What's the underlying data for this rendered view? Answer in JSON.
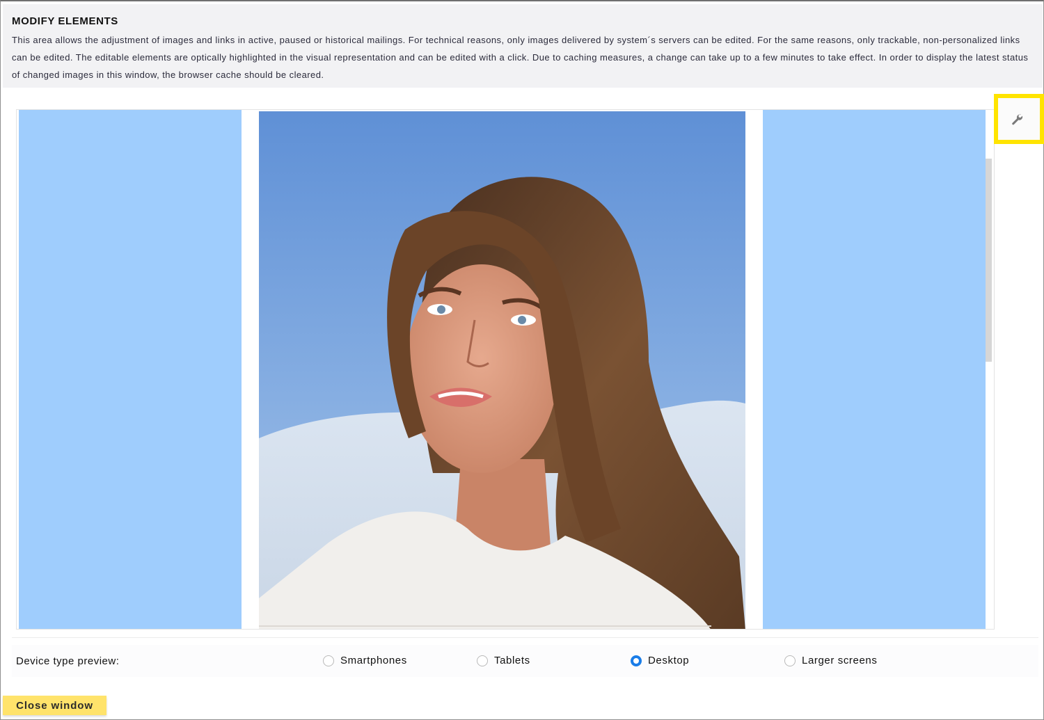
{
  "header": {
    "title": "MODIFY ELEMENTS",
    "description": "This area allows the adjustment of images and links in active, paused or historical mailings. For technical reasons, only images delivered by system´s servers can be edited. For the same reasons, only trackable, non-personalized links can be edited. The editable elements are optically highlighted in the visual representation and can be edited with a click. Due to caching measures, a change can take up to a few minutes to take effect. In order to display the latest status of changed images in this window, the browser cache should be cleared."
  },
  "preview": {
    "highlight_color": "#9fcdfd",
    "tool_icon": "wrench-icon",
    "tool_highlight_color": "#ffe400"
  },
  "device_preview": {
    "label": "Device type preview:",
    "options": [
      "Smartphones",
      "Tablets",
      "Desktop",
      "Larger screens"
    ],
    "selected": "Desktop",
    "selected_color": "#1a7de8"
  },
  "footer": {
    "close_label": "Close window",
    "close_color": "#ffe36b"
  }
}
